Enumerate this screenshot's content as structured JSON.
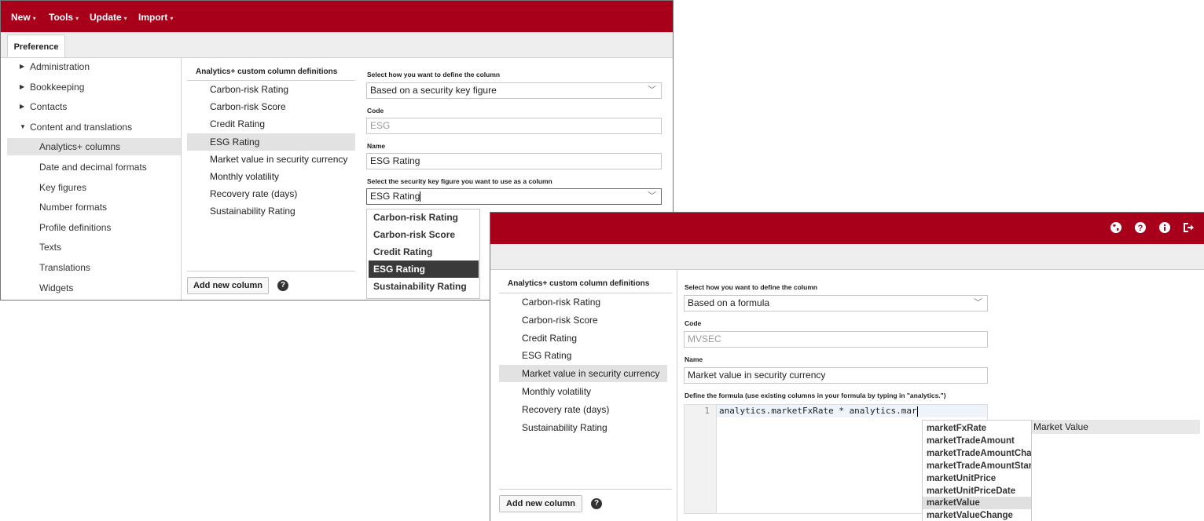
{
  "window1": {
    "menu": [
      {
        "label": "New"
      },
      {
        "label": "Tools"
      },
      {
        "label": "Update"
      },
      {
        "label": "Import"
      }
    ],
    "tab": "Preference",
    "nav": [
      {
        "label": "Administration",
        "kind": "collapsed"
      },
      {
        "label": "Bookkeeping",
        "kind": "collapsed"
      },
      {
        "label": "Contacts",
        "kind": "collapsed"
      },
      {
        "label": "Content and translations",
        "kind": "expanded"
      },
      {
        "label": "Analytics+ columns",
        "kind": "leaf",
        "selected": true
      },
      {
        "label": "Date and decimal formats",
        "kind": "leaf"
      },
      {
        "label": "Key figures",
        "kind": "leaf"
      },
      {
        "label": "Number formats",
        "kind": "leaf"
      },
      {
        "label": "Profile definitions",
        "kind": "leaf"
      },
      {
        "label": "Texts",
        "kind": "leaf"
      },
      {
        "label": "Translations",
        "kind": "leaf"
      },
      {
        "label": "Widgets",
        "kind": "leaf"
      }
    ],
    "columns_heading": "Analytics+ custom column definitions",
    "columns": [
      {
        "label": "Carbon-risk Rating"
      },
      {
        "label": "Carbon-risk Score"
      },
      {
        "label": "Credit Rating"
      },
      {
        "label": "ESG Rating",
        "selected": true
      },
      {
        "label": "Market value in security currency"
      },
      {
        "label": "Monthly volatility"
      },
      {
        "label": "Recovery rate (days)"
      },
      {
        "label": "Sustainability Rating"
      }
    ],
    "add_button": "Add new column",
    "help": "?",
    "form": {
      "define_label": "Select how you want to define the column",
      "define_value": "Based on a security key figure",
      "code_label": "Code",
      "code_value": "ESG",
      "name_label": "Name",
      "name_value": "ESG Rating",
      "keyfig_label": "Select the security key figure you want to use as a column",
      "keyfig_value": "ESG Rating"
    },
    "keyfig_options": [
      {
        "label": "Carbon-risk Rating"
      },
      {
        "label": "Carbon-risk Score"
      },
      {
        "label": "Credit Rating"
      },
      {
        "label": "ESG Rating",
        "selected": true
      },
      {
        "label": "Sustainability Rating"
      }
    ]
  },
  "window2": {
    "header_icons": [
      "globe-icon",
      "help-icon",
      "info-icon",
      "logout-icon"
    ],
    "columns_heading": "Analytics+ custom column definitions",
    "columns": [
      {
        "label": "Carbon-risk Rating"
      },
      {
        "label": "Carbon-risk Score"
      },
      {
        "label": "Credit Rating"
      },
      {
        "label": "ESG Rating"
      },
      {
        "label": "Market value in security currency",
        "selected": true
      },
      {
        "label": "Monthly volatility"
      },
      {
        "label": "Recovery rate (days)"
      },
      {
        "label": "Sustainability Rating"
      }
    ],
    "add_button": "Add new column",
    "help": "?",
    "form": {
      "define_label": "Select how you want to define the column",
      "define_value": "Based on a formula",
      "code_label": "Code",
      "code_value": "MVSEC",
      "name_label": "Name",
      "name_value": "Market value in security currency",
      "formula_label": "Define the formula (use existing columns in your formula by typing in \"analytics.\")",
      "line_number": "1",
      "formula": "analytics.marketFxRate * analytics.mar"
    },
    "autocomplete": [
      {
        "label": "marketFxRate"
      },
      {
        "label": "marketTradeAmount"
      },
      {
        "label": "marketTradeAmountCha"
      },
      {
        "label": "marketTradeAmountStar"
      },
      {
        "label": "marketUnitPrice"
      },
      {
        "label": "marketUnitPriceDate"
      },
      {
        "label": "marketValue",
        "selected": true
      },
      {
        "label": "marketValueChange"
      }
    ],
    "autocomplete_doc": "Market Value"
  }
}
